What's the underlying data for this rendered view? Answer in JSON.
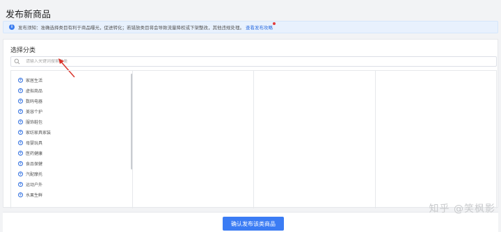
{
  "header": {
    "title": "发布新商品"
  },
  "notice": {
    "text": "发布须知：准确选择类目有利于商品曝光，促进转化；若错放类目将会导致流量降权或下架整改，其他违规处理。",
    "link": "查看发布攻略",
    "info_icon": "info-icon"
  },
  "category": {
    "title": "选择分类",
    "search_placeholder": "请输入关键词搜索分类",
    "items": [
      "家居生活",
      "虚拟商品",
      "数码电器",
      "美容个护",
      "服饰鞋包",
      "家纺家具家装",
      "母婴玩具",
      "医药健康",
      "食品保健",
      "汽配摩托",
      "运动户外",
      "水果生鲜"
    ]
  },
  "footer": {
    "confirm_label": "确认发布该类商品"
  },
  "watermark": "知乎 @笑枫影",
  "colors": {
    "primary": "#3b7cf4",
    "notice_bg": "#e8f1fd",
    "arrow": "#d9342b"
  }
}
